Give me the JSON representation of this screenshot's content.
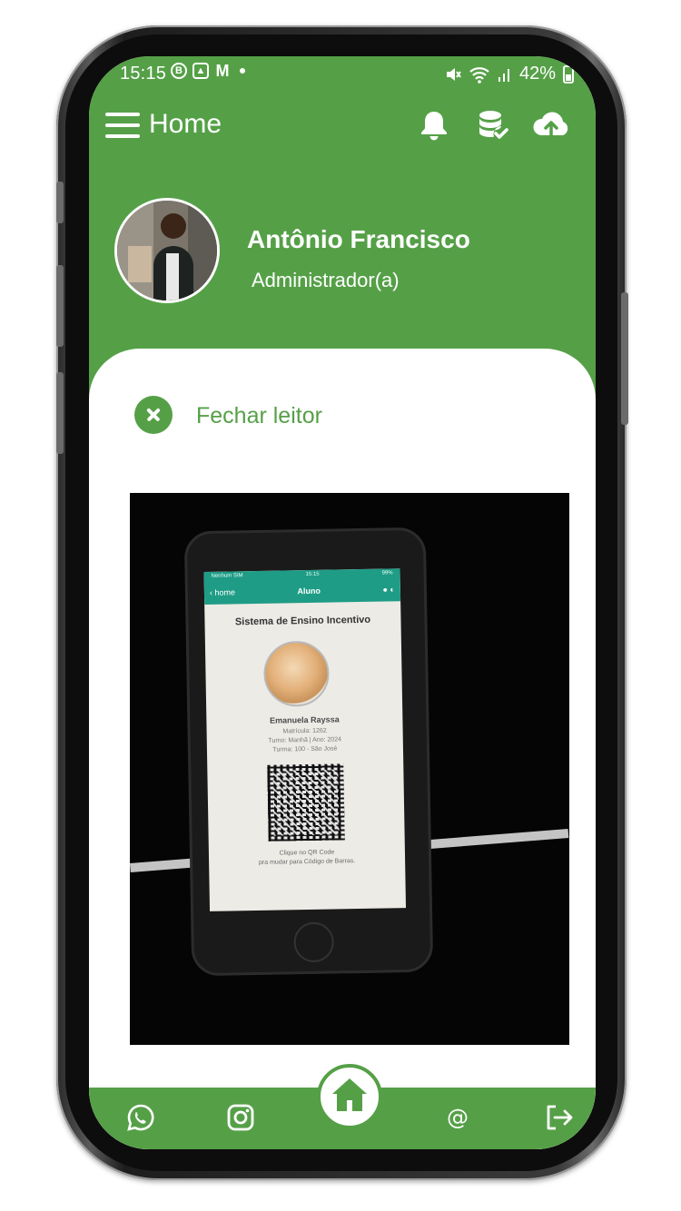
{
  "status_bar": {
    "time": "15:15",
    "battery": "42%",
    "left_icons": [
      "b-circle-icon",
      "image-icon",
      "gmail-icon",
      "dot-icon"
    ],
    "right_icons": [
      "mute-icon",
      "wifi-icon",
      "signal-icon",
      "battery-icon"
    ]
  },
  "app_bar": {
    "title": "Home",
    "icons": [
      "menu-icon",
      "bell-icon",
      "database-check-icon",
      "cloud-upload-icon"
    ]
  },
  "user": {
    "name": "Antônio Francisco",
    "role": "Administrador(a)"
  },
  "reader": {
    "close_label": "Fechar leitor"
  },
  "camera_preview": {
    "nav_back": "home",
    "nav_title": "Aluno",
    "status_left": "Nenhum SIM",
    "status_time": "15:15",
    "status_battery": "99%",
    "school": "Sistema de Ensino Incentivo",
    "student_name": "Emanuela Rayssa",
    "matricula": "Matrícula: 1262",
    "turno": "Turno: Manhã | Ano: 2024",
    "turma": "Turma: 100 - São José",
    "hint_line1": "Clique no QR Code",
    "hint_line2": "pra mudar para Código de Barras."
  },
  "bottom_nav": {
    "items": [
      "whatsapp-icon",
      "instagram-icon",
      "home-icon",
      "at-sign-icon",
      "logout-icon"
    ]
  },
  "colors": {
    "primary_green": "#55a047",
    "preview_teal": "#1f9c86"
  }
}
